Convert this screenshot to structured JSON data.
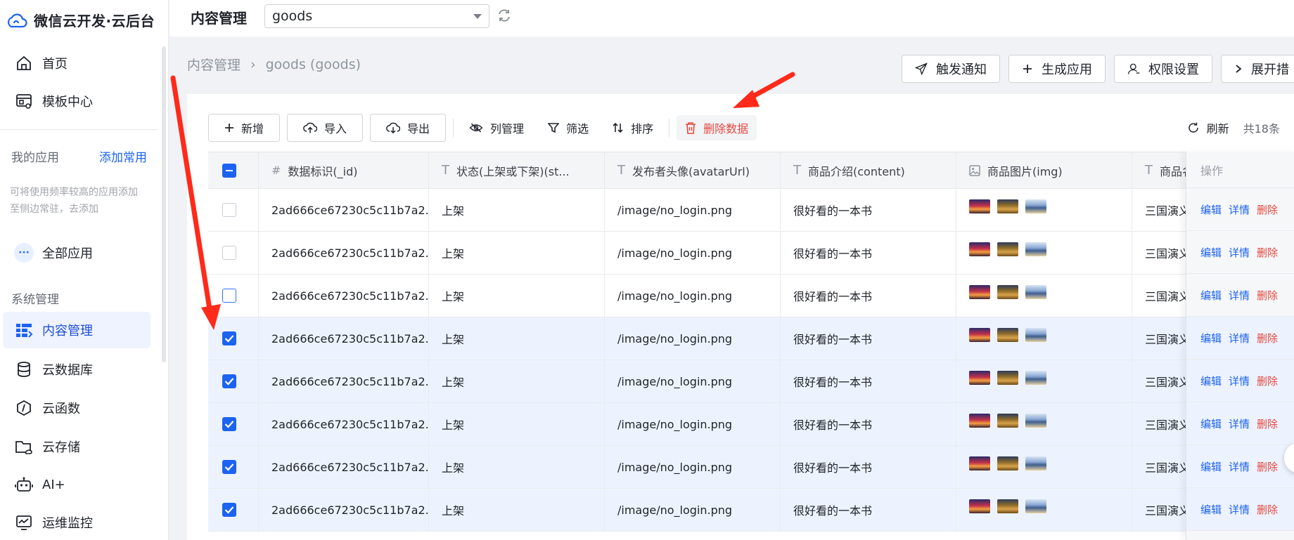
{
  "brand": {
    "title": "微信云开发·云后台"
  },
  "sidebar": {
    "items_top": [
      {
        "label": "首页",
        "icon": "home-icon"
      },
      {
        "label": "模板中心",
        "icon": "template-icon"
      }
    ],
    "my_apps": {
      "label": "我的应用",
      "add_label": "添加常用",
      "hint": "可将使用频率较高的应用添加至侧边常驻，去添加"
    },
    "all_apps": {
      "label": "全部应用",
      "icon": "more-icon"
    },
    "system": {
      "label": "系统管理",
      "items": [
        {
          "label": "内容管理",
          "icon": "content-icon",
          "active": true
        },
        {
          "label": "云数据库",
          "icon": "database-icon"
        },
        {
          "label": "云函数",
          "icon": "function-icon"
        },
        {
          "label": "云存储",
          "icon": "storage-icon"
        },
        {
          "label": "AI+",
          "icon": "robot-icon"
        },
        {
          "label": "运维监控",
          "icon": "monitor-icon"
        }
      ]
    }
  },
  "topbar": {
    "title": "内容管理",
    "collection_select": {
      "value": "goods"
    }
  },
  "breadcrumb": {
    "root": "内容管理",
    "separator": "›",
    "current": "goods (goods)"
  },
  "top_actions": [
    {
      "label": "触发通知",
      "icon": "send-icon"
    },
    {
      "label": "生成应用",
      "icon": "plus-icon"
    },
    {
      "label": "权限设置",
      "icon": "user-icon"
    },
    {
      "label": "展开措",
      "icon": "chevron-right-icon"
    }
  ],
  "toolbar": {
    "add": "新增",
    "import": "导入",
    "export": "导出",
    "columns": "列管理",
    "filter": "筛选",
    "sort": "排序",
    "delete_data": "删除数据",
    "refresh": "刷新",
    "total": "共18条"
  },
  "table": {
    "headers": {
      "id": "数据标识(_id)",
      "status": "状态(上架或下架)(st...",
      "avatar": "发布者头像(avatarUrl)",
      "content": "商品介绍(content)",
      "img": "商品图片(img)",
      "name": "商品名称",
      "ops": "操作"
    },
    "header_icons": {
      "id": "#",
      "text": "T"
    },
    "rows": [
      {
        "checked": false,
        "id": "2ad666ce67230c5c11b7a2...",
        "status": "上架",
        "avatar": "/image/no_login.png",
        "content": "很好看的一本书",
        "name": "三国演义"
      },
      {
        "checked": false,
        "id": "2ad666ce67230c5c11b7a2...",
        "status": "上架",
        "avatar": "/image/no_login.png",
        "content": "很好看的一本书",
        "name": "三国演义"
      },
      {
        "checked": false,
        "hover": true,
        "id": "2ad666ce67230c5c11b7a2...",
        "status": "上架",
        "avatar": "/image/no_login.png",
        "content": "很好看的一本书",
        "name": "三国演义"
      },
      {
        "checked": true,
        "id": "2ad666ce67230c5c11b7a2...",
        "status": "上架",
        "avatar": "/image/no_login.png",
        "content": "很好看的一本书",
        "name": "三国演义"
      },
      {
        "checked": true,
        "id": "2ad666ce67230c5c11b7a2...",
        "status": "上架",
        "avatar": "/image/no_login.png",
        "content": "很好看的一本书",
        "name": "三国演义"
      },
      {
        "checked": true,
        "id": "2ad666ce67230c5c11b7a2...",
        "status": "上架",
        "avatar": "/image/no_login.png",
        "content": "很好看的一本书",
        "name": "三国演义"
      },
      {
        "checked": true,
        "id": "2ad666ce67230c5c11b7a2...",
        "status": "上架",
        "avatar": "/image/no_login.png",
        "content": "很好看的一本书",
        "name": "三国演义"
      },
      {
        "checked": true,
        "id": "2ad666ce67230c5c11b7a2...",
        "status": "上架",
        "avatar": "/image/no_login.png",
        "content": "很好看的一本书",
        "name": "三国演义"
      }
    ],
    "row_actions": {
      "edit": "编辑",
      "detail": "详情",
      "delete": "删除"
    }
  },
  "colors": {
    "primary": "#1d63f1",
    "danger": "#e5483f",
    "selected_row": "#edf3fe",
    "annotation": "#ff2a1a"
  }
}
